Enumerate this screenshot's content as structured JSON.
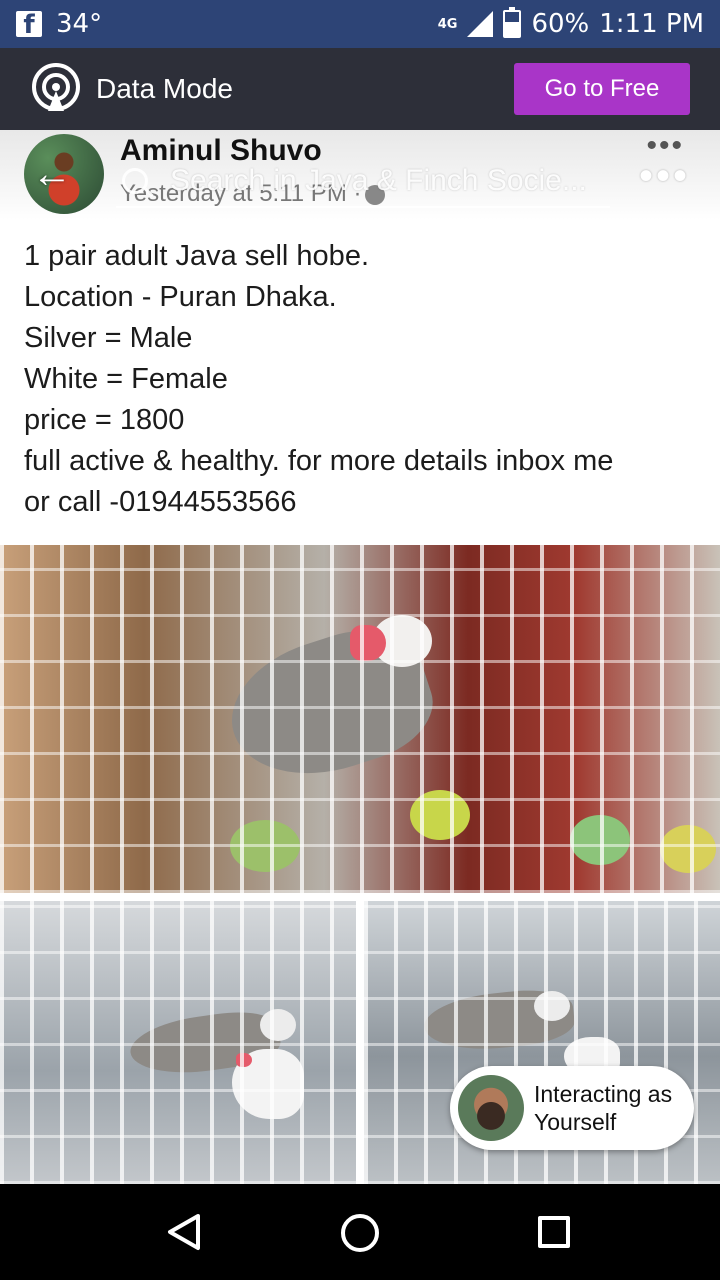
{
  "status_bar": {
    "app_icon": "facebook-icon",
    "temperature": "34°",
    "network": "4G",
    "battery_percent": "60%",
    "battery_level": 0.6,
    "time": "1:11 PM"
  },
  "data_bar": {
    "icon": "broadcast-icon",
    "label": "Data Mode",
    "button_label": "Go to Free",
    "button_color": "#a935c8"
  },
  "post": {
    "author": "Aminul Shuvo",
    "timestamp": "Yesterday at 5:11 PM ·",
    "search_placeholder": "Search in Java & Finch Socie...",
    "body_lines": [
      "1 pair adult Java sell hobe.",
      "Location - Puran Dhaka.",
      "Silver = Male",
      "White = Female",
      "price = 1800",
      "full active & healthy. for more details inbox me",
      "or call -01944553566"
    ]
  },
  "chip": {
    "line1": "Interacting as",
    "line2": "Yourself"
  },
  "colors": {
    "status_bar": "#2d4476",
    "data_bar": "#2d2f39"
  }
}
